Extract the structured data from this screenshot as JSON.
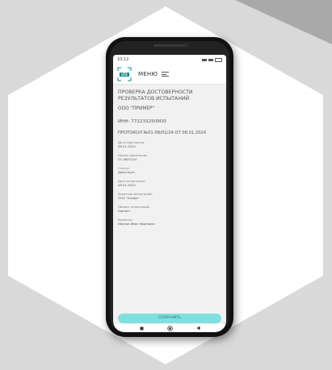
{
  "status_bar": {
    "time": "10:12"
  },
  "header": {
    "logo_text": "LTS",
    "menu_label": "МЕНЮ"
  },
  "page": {
    "title": "ПРОВЕРКА ДОСТОВЕРНОСТИ РЕЗУЛЬТАТОВ ИСПЫТАНИЙ",
    "organization": "ООО \"ПРИМЕР\"",
    "inn": "ИНН: 7722332509О0",
    "protocol": "ПРОТОКОЛ №01-08/01/24 ОТ 08.01.2024"
  },
  "fields": [
    {
      "label": "Дата протокола:",
      "value": "08.01.2024"
    },
    {
      "label": "Номер протокола:",
      "value": "01-08/01/24"
    },
    {
      "label": "Статус:",
      "value": "Действует"
    },
    {
      "label": "Дата испытания:",
      "value": "08.01.2024"
    },
    {
      "label": "Заказчик испытаний:",
      "value": "ООО \"Альфа\""
    },
    {
      "label": "Объект испытаний:",
      "value": "Кирпич"
    },
    {
      "label": "Испытал:",
      "value": "Иванов Иван Иванович"
    }
  ],
  "actions": {
    "save_label": "СОХРАНИТЬ"
  },
  "colors": {
    "accent": "#7fe0de",
    "logo": "#0e8a8a"
  }
}
